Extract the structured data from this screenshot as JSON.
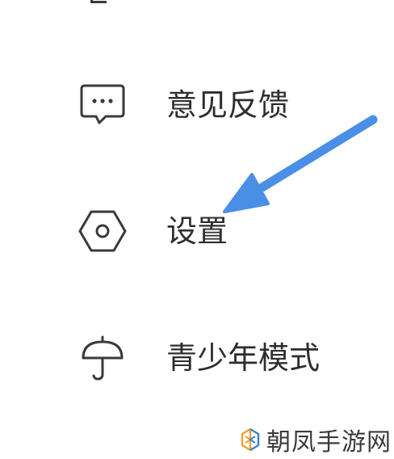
{
  "menu": {
    "items": [
      {
        "label": "意见反馈",
        "icon": "chat-bubble-icon"
      },
      {
        "label": "设置",
        "icon": "hexagon-gear-icon"
      },
      {
        "label": "青少年模式",
        "icon": "umbrella-icon"
      }
    ]
  },
  "annotation": {
    "arrow_color": "#4a8fe6",
    "icon": "arrow-pointing-to-settings-icon"
  },
  "watermark": {
    "text": "朝凤手游网",
    "logo_colors": [
      "#f0a030",
      "#3a7fd8"
    ]
  }
}
